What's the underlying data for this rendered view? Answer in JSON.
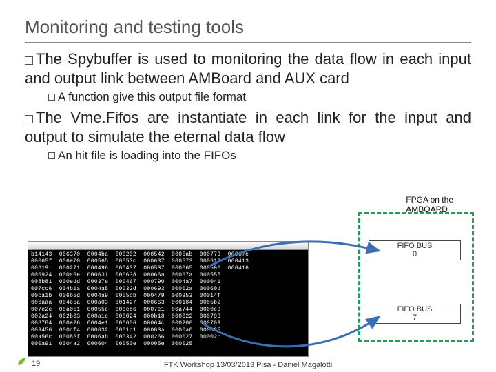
{
  "title": "Monitoring and testing tools",
  "bullets": {
    "b1": "The Spybuffer is used to monitoring the data flow in each input and output link between AMBoard and AUX card",
    "b1a": "A function give this output file format",
    "b2": "The Vme.Fifos are instantiate in each link for the input and output to simulate the eternal data flow",
    "b2a": "An hit file is loading into the FIFOs"
  },
  "side_label_line1": "FPGA on the",
  "side_label_line2": "AMBOARD",
  "fifo0_line1": "FIFO BUS",
  "fifo0_line2": "0",
  "fifo7_line1": "FIFO BUS",
  "fifo7_line2": "7",
  "terminal_lines": "b14143  006370  0004ba  000202  000542  0005ab  000773  00067c\n00065f  006e70  000565  00053c  000637  000573  000619  000413\n00619:  000271  000496  000437  000537  000065  000590  000416\n006924  000a6e  000631  000638  00066a  00067a  000555\n008b81  000edd  00037e  000467  000790  0004a7  000041\n007cc6  004b1a  0004a5  00032d  000693  00002a  00060d\n00ca1b  006b5d  0004a9  0005cb  000479  000353  00014f\n006aaa  004c5a  000a03  001427  000663  000184  0005b2\n007c2e  00a051  00055c  000c86  0007e1  00a744  0000e9\n002a24  002b03  000a1c  000024  000b18  000022  000793\n008784  000e26  0004e1  000606  00064c  000206  000709\n009456  000cf4  000632  0001c1  00003a  0000a0  000025\n00a56c  00086f  0006ab  000342  000266  000027  00002c\n000a91  0004a2  000604  00050e  00005e  000025",
  "footer_text": "FTK Workshop 13/03/2013 Pisa - Daniel Magalotti",
  "page_number": "19"
}
